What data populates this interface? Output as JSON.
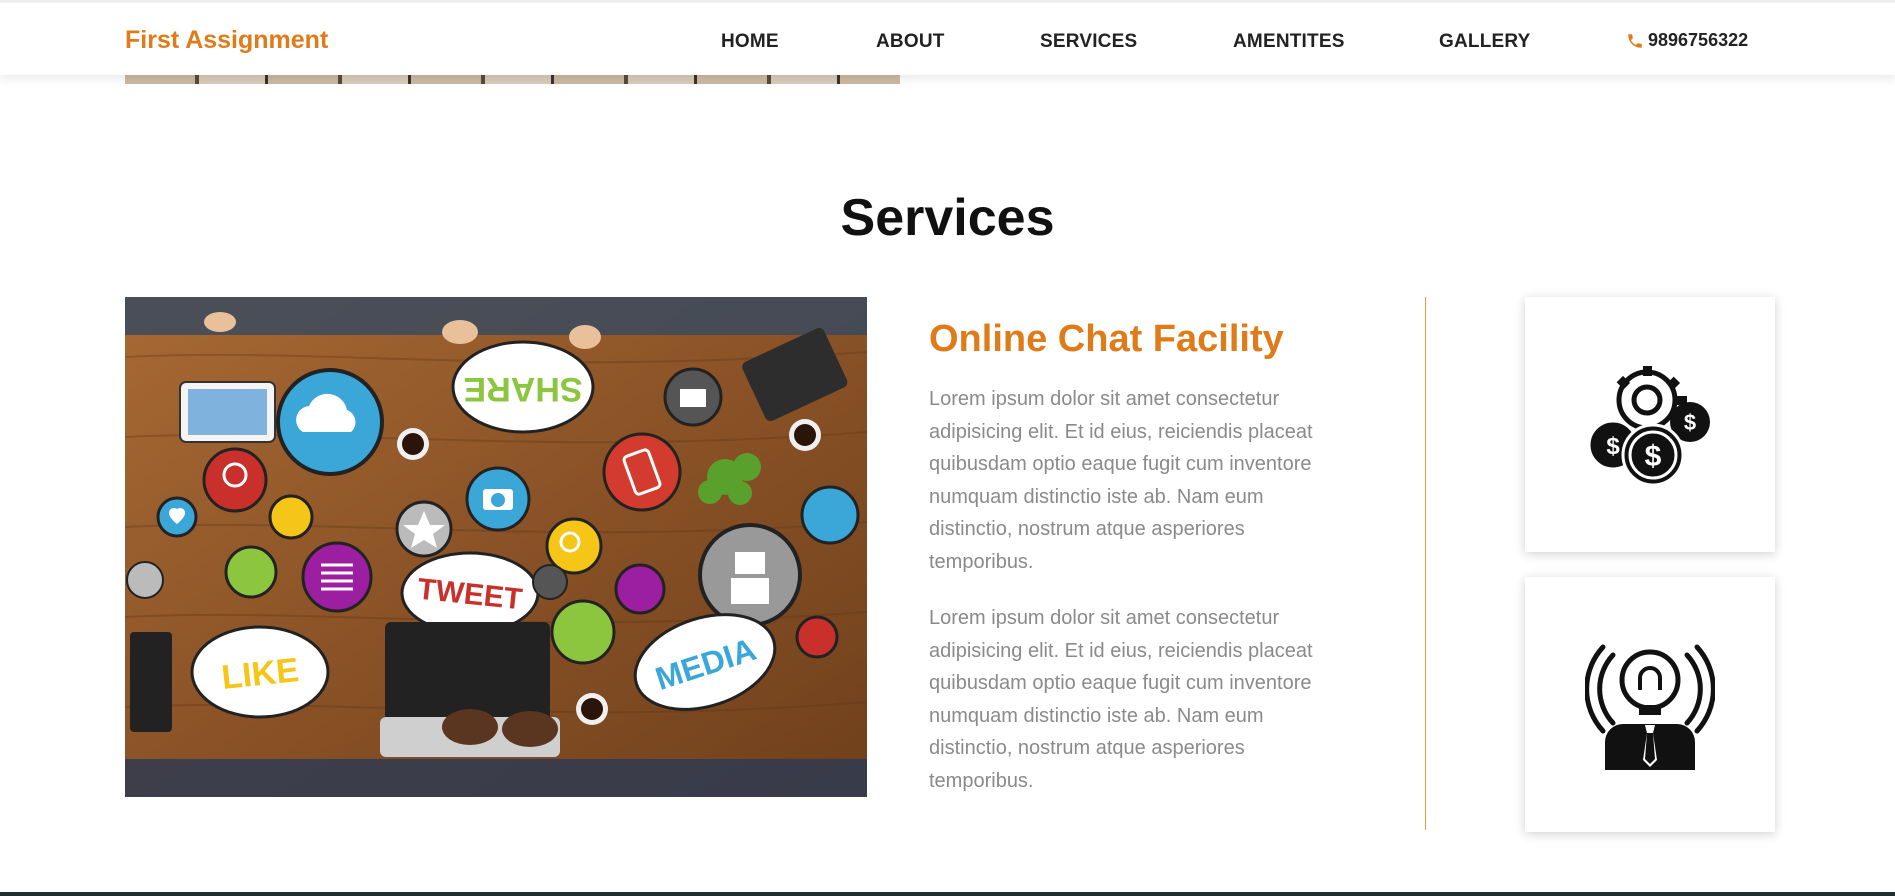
{
  "brand": "First Assignment",
  "nav": {
    "items": [
      {
        "label": "HOME"
      },
      {
        "label": "ABOUT"
      },
      {
        "label": "SERVICES"
      },
      {
        "label": "AMENTITES"
      },
      {
        "label": "GALLERY"
      }
    ],
    "phone": "9896756322",
    "phone_icon": "phone-icon"
  },
  "services": {
    "title": "Services",
    "heading": "Online Chat Facility",
    "paragraphs": [
      "Lorem ipsum dolor sit amet consectetur adipisicing elit. Et id eius, reiciendis placeat quibusdam optio eaque fugit cum inventore numquam distinctio iste ab. Nam eum distinctio, nostrum atque asperiores temporibus.",
      "Lorem ipsum dolor sit amet consectetur adipisicing elit. Et id eius, reiciendis placeat quibusdam optio eaque fugit cum inventore numquam distinctio iste ab. Nam eum distinctio, nostrum atque asperiores temporibus."
    ],
    "image": {
      "bubbles": [
        "SHARE",
        "TWEET",
        "LIKE",
        "MEDIA"
      ]
    },
    "cards": [
      {
        "icon": "money-gear-icon"
      },
      {
        "icon": "idea-person-icon"
      }
    ]
  },
  "colors": {
    "accent": "#e07b1a",
    "text": "#222222",
    "muted": "#8a8a8a"
  }
}
